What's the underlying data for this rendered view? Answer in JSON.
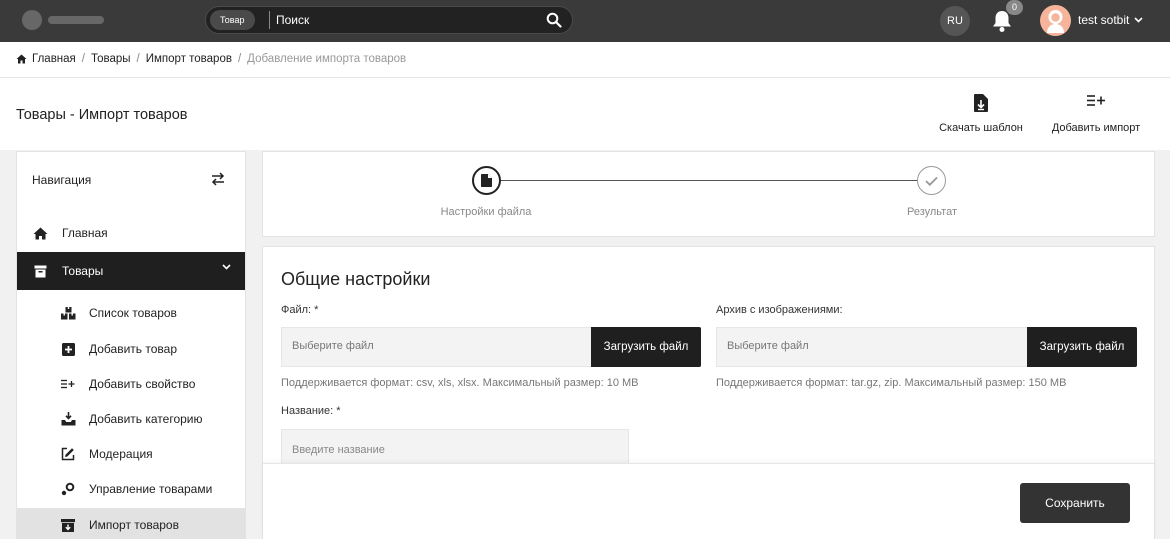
{
  "topbar": {
    "search_scope": "Товар",
    "search_placeholder": "Поиск",
    "language": "RU",
    "notifications_count": "0",
    "user_name": "test sotbit"
  },
  "breadcrumb": {
    "items": [
      "Главная",
      "Товары",
      "Импорт товаров"
    ],
    "current": "Добавление импорта товаров"
  },
  "header": {
    "title": "Товары - Импорт товаров",
    "actions": {
      "download_template": "Скачать шаблон",
      "add_import": "Добавить импорт"
    }
  },
  "sidebar": {
    "nav_label": "Навигация",
    "home": "Главная",
    "products": "Товары",
    "sub_items": [
      {
        "label": "Список товаров",
        "icon": "boxes-icon"
      },
      {
        "label": "Добавить товар",
        "icon": "plus-square-icon"
      },
      {
        "label": "Добавить свойство",
        "icon": "list-add-icon"
      },
      {
        "label": "Добавить категорию",
        "icon": "tray-download-icon"
      },
      {
        "label": "Модерация",
        "icon": "edit-icon"
      },
      {
        "label": "Управление товарами",
        "icon": "gears-icon"
      },
      {
        "label": "Импорт товаров",
        "icon": "box-import-icon"
      }
    ]
  },
  "stepper": {
    "step1": "Настройки файла",
    "step2": "Результат"
  },
  "form": {
    "section_title": "Общие настройки",
    "file_label": "Файл: *",
    "file_placeholder": "Выберите файл",
    "file_button": "Загрузить файл",
    "file_hint": "Поддерживается формат: csv, xls, xlsx. Максимальный размер: 10 MB",
    "archive_label": "Архив с изображениями:",
    "archive_placeholder": "Выберите файл",
    "archive_button": "Загрузить файл",
    "archive_hint": "Поддерживается формат: tar.gz, zip. Максимальный размер: 150 MB",
    "name_label": "Название: *",
    "name_placeholder": "Введите название",
    "save_button": "Сохранить"
  }
}
